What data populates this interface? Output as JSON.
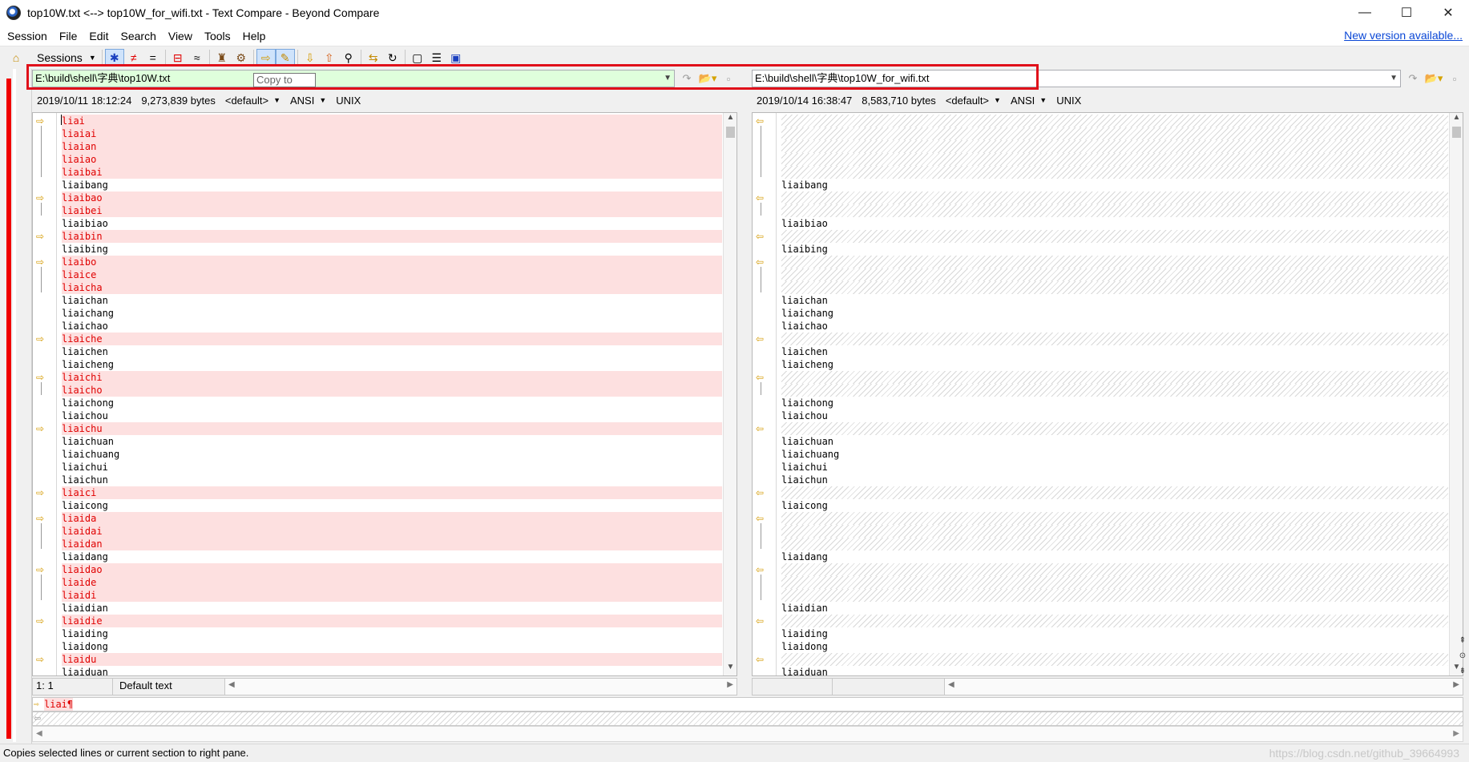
{
  "window": {
    "title": "top10W.txt <--> top10W_for_wifi.txt - Text Compare - Beyond Compare",
    "minimize": "—",
    "maximize": "☐",
    "close": "✕"
  },
  "menu": {
    "items": [
      "Session",
      "File",
      "Edit",
      "Search",
      "View",
      "Tools",
      "Help"
    ],
    "new_version": "New version available..."
  },
  "toolbar": {
    "sessions_label": "Sessions",
    "icons": [
      "home-icon",
      "all-icon",
      "diffs-icon",
      "same-icon",
      "context-icon",
      "minor-icon",
      "copy-to-right-icon",
      "edit-icon",
      "next-diff-icon",
      "prev-diff-icon",
      "find-icon",
      "swap-icon",
      "reload-icon",
      "options-icon",
      "rules-icon",
      "format-icon"
    ]
  },
  "left": {
    "path": "E:\\build\\shell\\字典\\top10W.txt",
    "timestamp": "2019/10/11 18:12:24",
    "size": "9,273,839 bytes",
    "format": "<default>",
    "encoding": "ANSI",
    "line_ending": "UNIX",
    "position": "1: 1",
    "status": "Default text"
  },
  "right": {
    "path": "E:\\build\\shell\\字典\\top10W_for_wifi.txt",
    "timestamp": "2019/10/14 16:38:47",
    "size": "8,583,710 bytes",
    "format": "<default>",
    "encoding": "ANSI",
    "line_ending": "UNIX"
  },
  "tooltip": "Copy to",
  "lines": [
    {
      "text": "liai",
      "diff": true,
      "arrow": true
    },
    {
      "text": "liaiai",
      "diff": true
    },
    {
      "text": "liaian",
      "diff": true
    },
    {
      "text": "liaiao",
      "diff": true
    },
    {
      "text": "liaibai",
      "diff": true
    },
    {
      "text": "liaibang",
      "diff": false
    },
    {
      "text": "liaibao",
      "diff": true,
      "arrow": true
    },
    {
      "text": "liaibei",
      "diff": true
    },
    {
      "text": "liaibiao",
      "diff": false
    },
    {
      "text": "liaibin",
      "diff": true,
      "arrow": true
    },
    {
      "text": "liaibing",
      "diff": false
    },
    {
      "text": "liaibo",
      "diff": true,
      "arrow": true
    },
    {
      "text": "liaice",
      "diff": true
    },
    {
      "text": "liaicha",
      "diff": true
    },
    {
      "text": "liaichan",
      "diff": false
    },
    {
      "text": "liaichang",
      "diff": false
    },
    {
      "text": "liaichao",
      "diff": false
    },
    {
      "text": "liaiche",
      "diff": true,
      "arrow": true
    },
    {
      "text": "liaichen",
      "diff": false
    },
    {
      "text": "liaicheng",
      "diff": false
    },
    {
      "text": "liaichi",
      "diff": true,
      "arrow": true
    },
    {
      "text": "liaicho",
      "diff": true
    },
    {
      "text": "liaichong",
      "diff": false
    },
    {
      "text": "liaichou",
      "diff": false
    },
    {
      "text": "liaichu",
      "diff": true,
      "arrow": true
    },
    {
      "text": "liaichuan",
      "diff": false
    },
    {
      "text": "liaichuang",
      "diff": false
    },
    {
      "text": "liaichui",
      "diff": false
    },
    {
      "text": "liaichun",
      "diff": false
    },
    {
      "text": "liaici",
      "diff": true,
      "arrow": true
    },
    {
      "text": "liaicong",
      "diff": false
    },
    {
      "text": "liaida",
      "diff": true,
      "arrow": true
    },
    {
      "text": "liaidai",
      "diff": true
    },
    {
      "text": "liaidan",
      "diff": true
    },
    {
      "text": "liaidang",
      "diff": false
    },
    {
      "text": "liaidao",
      "diff": true,
      "arrow": true
    },
    {
      "text": "liaide",
      "diff": true
    },
    {
      "text": "liaidi",
      "diff": true
    },
    {
      "text": "liaidian",
      "diff": false
    },
    {
      "text": "liaidie",
      "diff": true,
      "arrow": true
    },
    {
      "text": "liaiding",
      "diff": false
    },
    {
      "text": "liaidong",
      "diff": false
    },
    {
      "text": "liaidu",
      "diff": true,
      "arrow": true
    },
    {
      "text": "liaiduan",
      "diff": false
    }
  ],
  "detail": {
    "left_line": "liai¶"
  },
  "statusbar": {
    "text": "Copies selected lines or current section to right pane.",
    "watermark": "https://blog.csdn.net/github_39664993"
  }
}
